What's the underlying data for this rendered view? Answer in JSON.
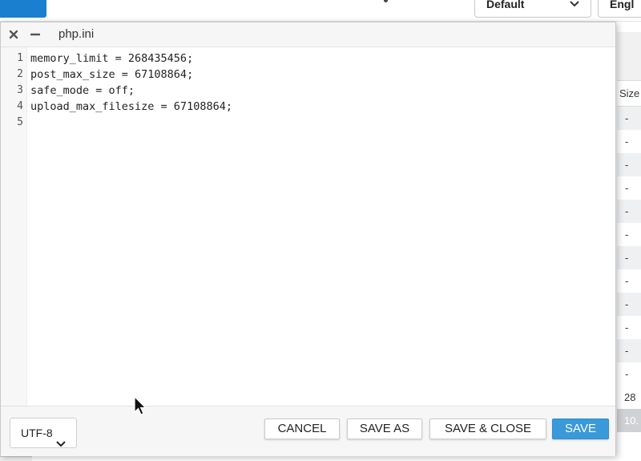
{
  "background": {
    "theme_select": "Default",
    "language_select": "Engl",
    "table": {
      "size_header": "Size",
      "rows": [
        "-",
        "-",
        "-",
        "-",
        "-",
        "-",
        "-",
        "-",
        "-",
        "-",
        "-",
        "-",
        "28",
        "10."
      ]
    }
  },
  "editor": {
    "title": "php.ini",
    "close_icon": "close-icon",
    "minimize_icon": "minimize-icon",
    "line_numbers": [
      "1",
      "2",
      "3",
      "4",
      "5"
    ],
    "lines": [
      "memory_limit = 268435456;",
      "post_max_size = 67108864;",
      "safe_mode = off;",
      "upload_max_filesize = 67108864;",
      ""
    ]
  },
  "footer": {
    "encoding": "UTF-8",
    "cancel_label": "CANCEL",
    "save_as_label": "SAVE AS",
    "save_close_label": "SAVE & CLOSE",
    "save_label": "SAVE"
  },
  "colors": {
    "primary": "#3a9ad9",
    "topbar_button": "#1a7fcf"
  }
}
